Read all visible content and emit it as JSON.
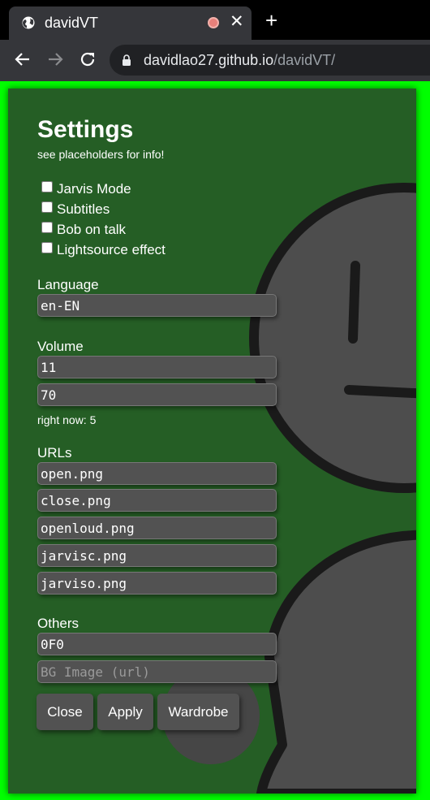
{
  "browser": {
    "tab_title": "davidVT",
    "url_host": "davidlao27.github.io",
    "url_path": "/davidVT/"
  },
  "settings": {
    "title": "Settings",
    "subtitle": "see placeholders for info!",
    "checkboxes": [
      {
        "label": "Jarvis Mode",
        "checked": false
      },
      {
        "label": "Subtitles",
        "checked": false
      },
      {
        "label": "Bob on talk",
        "checked": false
      },
      {
        "label": "Lightsource effect",
        "checked": false
      }
    ],
    "language": {
      "label": "Language",
      "value": "en-EN"
    },
    "volume": {
      "label": "Volume",
      "values": [
        "11",
        "70"
      ],
      "note": "right now: 5"
    },
    "urls": {
      "label": "URLs",
      "values": [
        "open.png",
        "close.png",
        "openloud.png",
        "jarvisc.png",
        "jarviso.png"
      ]
    },
    "others": {
      "label": "Others",
      "color_value": "0F0",
      "bg_image_placeholder": "BG Image (url)"
    },
    "buttons": {
      "close": "Close",
      "apply": "Apply",
      "wardrobe": "Wardrobe"
    }
  },
  "colors": {
    "page_background": "#00ff00",
    "panel_background": "#255e25",
    "avatar_fill": "#4d4d4d",
    "avatar_stroke": "#1a1a1a",
    "field_background": "#525252"
  }
}
